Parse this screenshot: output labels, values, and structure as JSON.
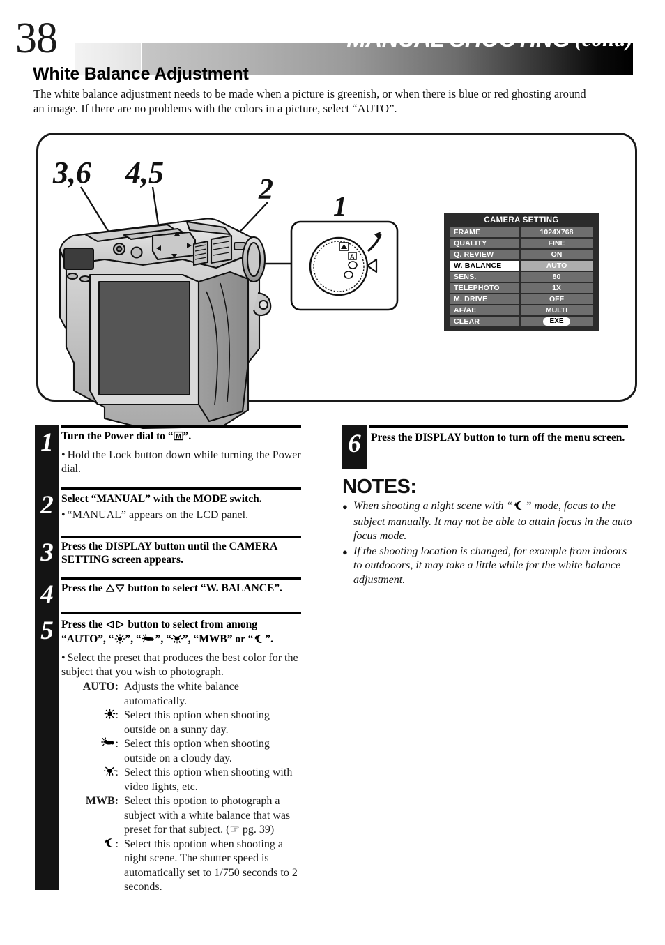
{
  "header": {
    "page_number": "38",
    "title_main": "MANUAL SHOOTING",
    "title_cont": "(cont.)"
  },
  "section": {
    "title": "White Balance Adjustment",
    "intro": "The white balance adjustment needs to be made when a picture is greenish, or when there is blue or red ghosting around an image. If there are no problems with the colors in a picture, select “AUTO”."
  },
  "illustration": {
    "callouts": [
      {
        "id": "callout-36",
        "label": "3,6"
      },
      {
        "id": "callout-45",
        "label": "4,5"
      },
      {
        "id": "callout-2",
        "label": "2"
      },
      {
        "id": "callout-1",
        "label": "1"
      }
    ]
  },
  "camera_setting_screen": {
    "title": "CAMERA SETTING",
    "rows": [
      {
        "label": "FRAME",
        "value": "1024X768",
        "selected": false
      },
      {
        "label": "QUALITY",
        "value": "FINE",
        "selected": false
      },
      {
        "label": "Q. REVIEW",
        "value": "ON",
        "selected": false
      },
      {
        "label": "W. BALANCE",
        "value": "AUTO",
        "selected": true
      },
      {
        "label": "SENS.",
        "value": "80",
        "selected": false
      },
      {
        "label": "TELEPHOTO",
        "value": "1X",
        "selected": false
      },
      {
        "label": "M. DRIVE",
        "value": "OFF",
        "selected": false
      },
      {
        "label": "AF/AE",
        "value": "MULTI",
        "selected": false
      },
      {
        "label": "CLEAR",
        "value": "EXE",
        "selected": false,
        "pill": true
      }
    ]
  },
  "steps_left": [
    {
      "number": "1",
      "heading_pre": "Turn the Power dial to “",
      "heading_icon": "M",
      "heading_post": "”.",
      "bullets": [
        "Hold the Lock button down while turning the Power dial."
      ]
    },
    {
      "number": "2",
      "heading": "Select “MANUAL” with the MODE switch.",
      "bullets": [
        "“MANUAL” appears on the LCD panel."
      ]
    },
    {
      "number": "3",
      "heading": "Press the DISPLAY button until the CAMERA SETTING screen appears.",
      "bullets": []
    },
    {
      "number": "4",
      "heading_pre": "Press the ",
      "heading_icons": "up-down-triangles",
      "heading_post": " button to select “W. BALANCE”.",
      "bullets": []
    },
    {
      "number": "5",
      "heading_pre": "Press the ",
      "heading_icons": "left-right-triangles",
      "heading_post": " button to select from among “AUTO”, “sun-icon”, “cloud-icon”, “lamp-icon”, “MWB” or “moon-icon”.",
      "heading_line1_post": " button to select from among",
      "heading_line2": "“AUTO”, “ ”, “ ”, “ ”, “MWB” or “ ”.",
      "bullets": [
        "Select the preset that produces the best color for the subject that you wish to photograph."
      ],
      "definitions": [
        {
          "term": "AUTO:",
          "term_kind": "text",
          "desc": "Adjusts the white balance automatically."
        },
        {
          "term": "",
          "term_kind": "sun",
          "desc": "Select this option when shooting outside on a sunny day."
        },
        {
          "term": "",
          "term_kind": "cloud",
          "desc": "Select this option when shooting outside on a cloudy day."
        },
        {
          "term": "",
          "term_kind": "lamp",
          "desc": "Select this option when shooting with video lights, etc."
        },
        {
          "term": "MWB:",
          "term_kind": "text",
          "desc": "Select this opotion to photograph a subject with a white balance that was preset for that subject. (☞ pg. 39)"
        },
        {
          "term": "",
          "term_kind": "moon",
          "desc": "Select this opotion when shooting a night scene. The shutter speed is automatically set to 1/750 seconds to 2 seconds."
        }
      ]
    }
  ],
  "step_right": {
    "number": "6",
    "heading": "Press the DISPLAY button to turn off the menu screen."
  },
  "notes": {
    "heading": "NOTES:",
    "items": [
      "When shooting a night scene with “moon-icon” mode, focus to the subject manually. It may not be able to attain focus in the auto focus mode.",
      "If the shooting location is changed, for example from indoors to outdooors, it may take a little while for the white balance adjustment."
    ],
    "item_1_pre": "When shooting a night scene with “",
    "item_1_post": "” mode, focus to the subject manually. It may not be able to attain focus in the auto focus mode.",
    "item_2": "If the shooting location is changed, for example from indoors to outdooors, it may take a little while for the white balance adjustment."
  },
  "colors": {
    "ink": "#111111",
    "osd_background": "#2b2b2b",
    "osd_row": "#6e6e6e",
    "osd_selected_value": "#adadad",
    "bar_black": "#141414"
  }
}
